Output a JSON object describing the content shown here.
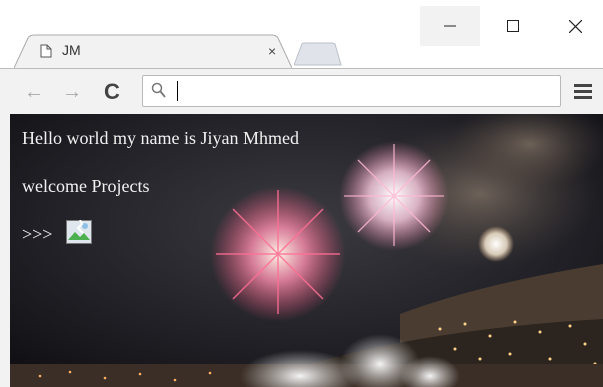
{
  "window": {
    "minimize_icon": "minimize-icon",
    "maximize_icon": "maximize-icon",
    "close_icon": "close-icon"
  },
  "tab": {
    "title": "JM",
    "close_glyph": "×"
  },
  "toolbar": {
    "back_glyph": "←",
    "forward_glyph": "→",
    "reload_glyph": "C",
    "address_value": "",
    "address_placeholder": ""
  },
  "page": {
    "line1": "Hello world my name is Jiyan Mhmed",
    "line2": "welcome Projects",
    "line3": ">>>"
  },
  "colors": {
    "chrome_bg": "#f2f2f2",
    "text_on_image": "#f2f2f2"
  }
}
